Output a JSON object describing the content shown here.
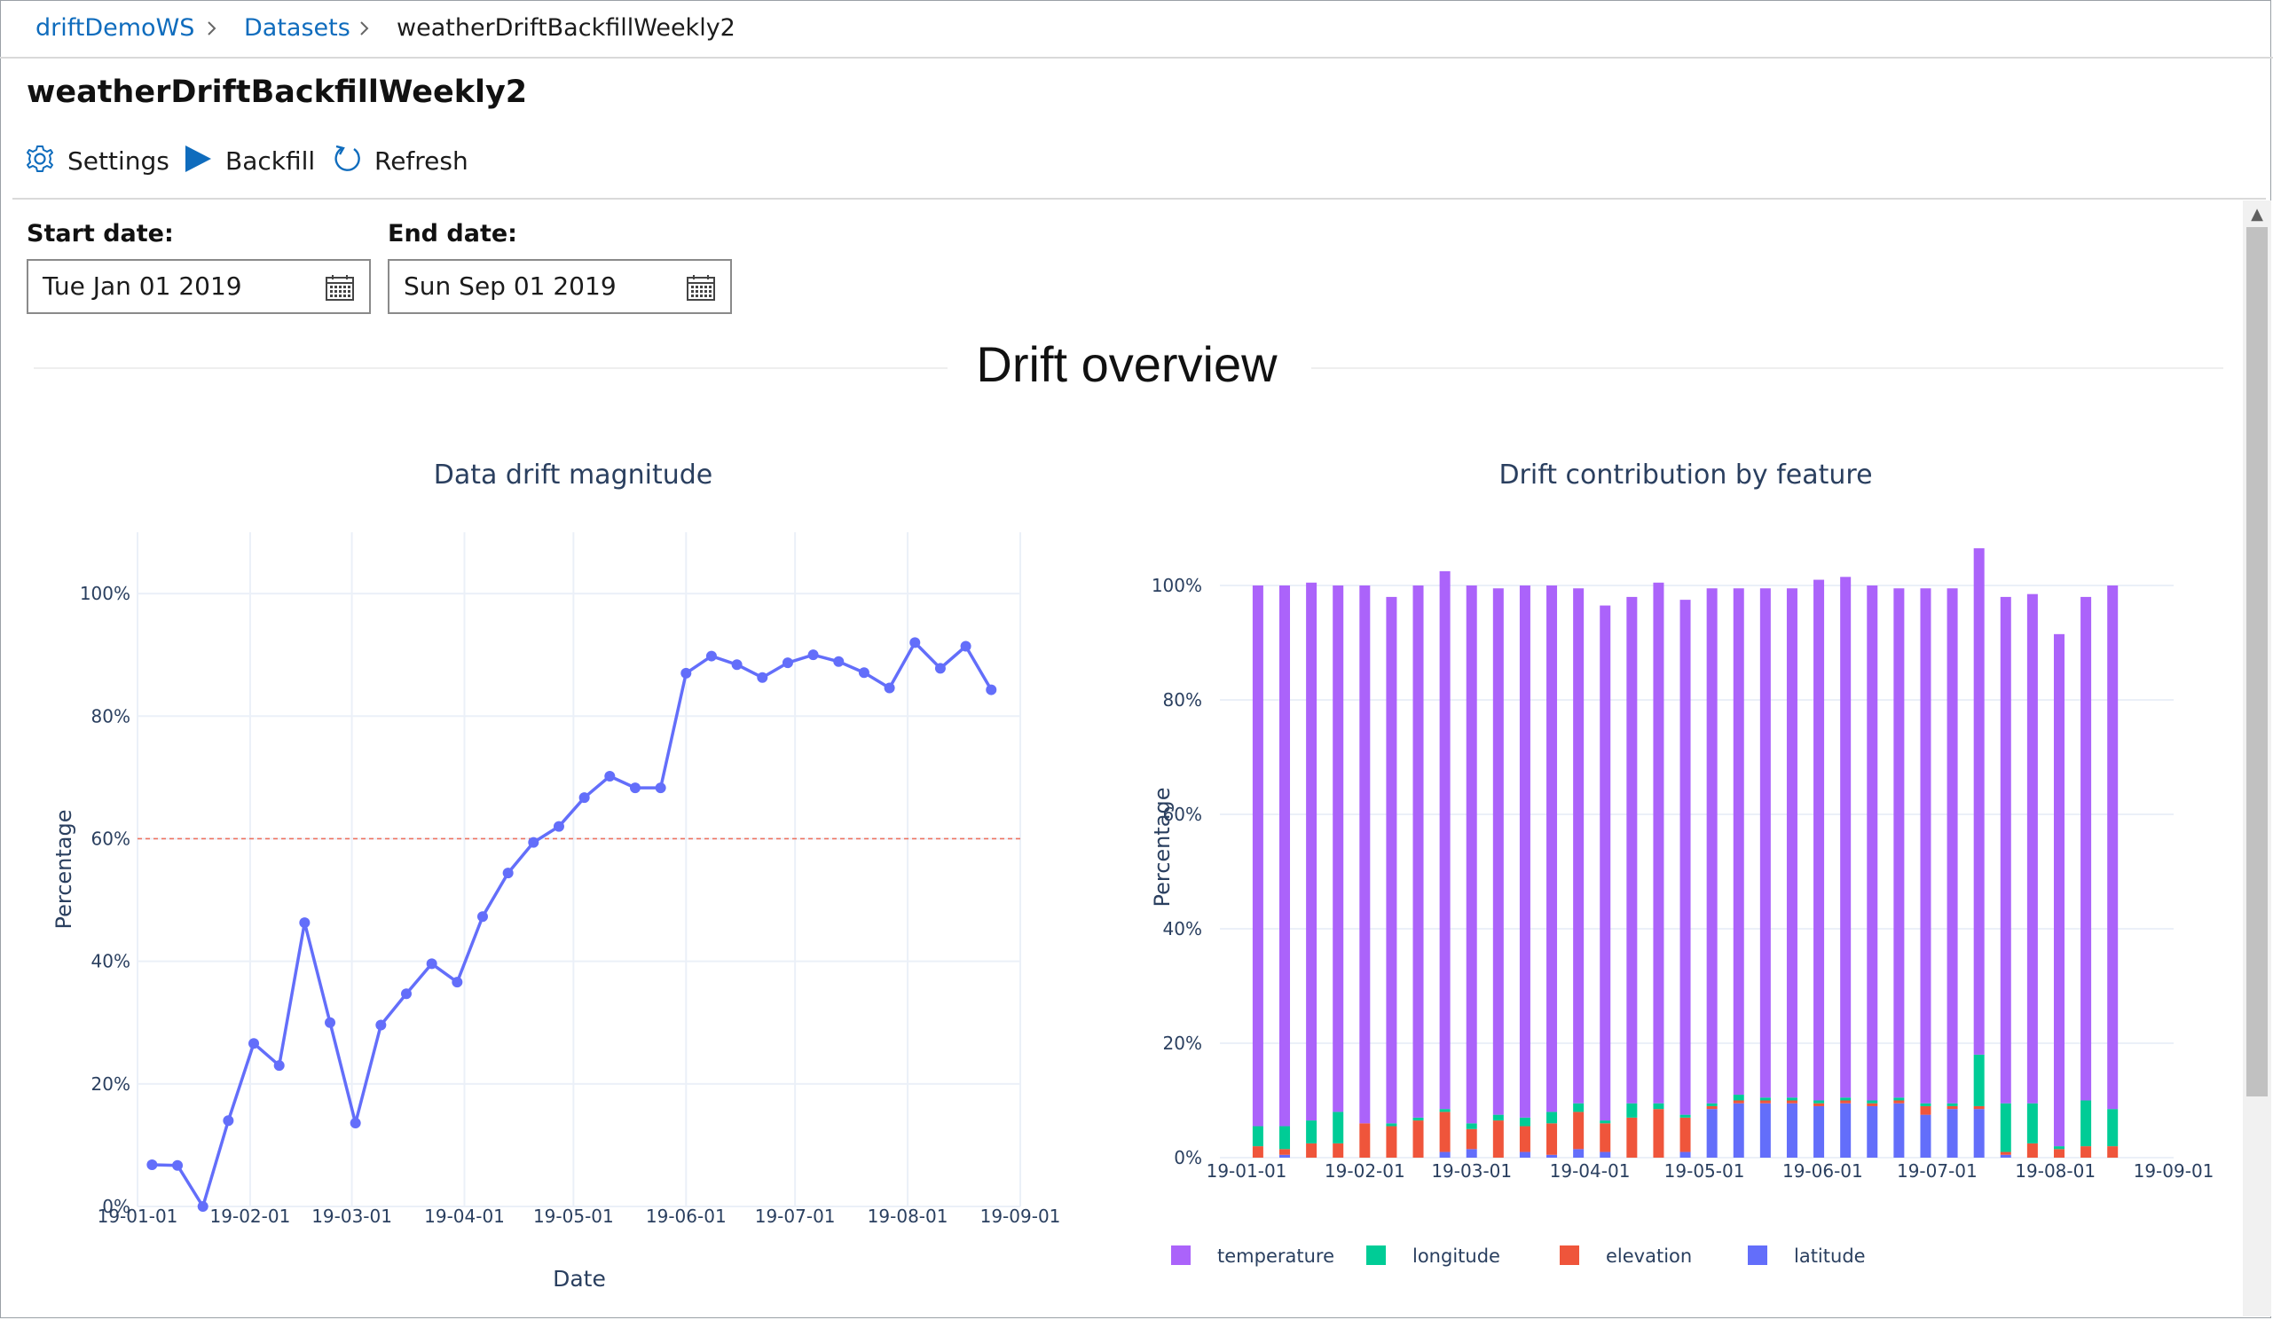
{
  "breadcrumb": {
    "items": [
      "driftDemoWS",
      "Datasets",
      "weatherDriftBackfillWeekly2"
    ]
  },
  "page": {
    "title": "weatherDriftBackfillWeekly2"
  },
  "toolbar": {
    "settings_label": "Settings",
    "backfill_label": "Backfill",
    "refresh_label": "Refresh"
  },
  "filters": {
    "start_label": "Start date:",
    "start_value": "Tue Jan 01 2019",
    "end_label": "End date:",
    "end_value": "Sun Sep 01 2019"
  },
  "section": {
    "title": "Drift overview"
  },
  "colors": {
    "accent": "#0f6cbd",
    "line": "#636efa",
    "threshold": "#ef553b",
    "temperature": "#ab63fa",
    "longitude": "#00cc96",
    "elevation": "#ef553b",
    "latitude": "#636efa"
  },
  "chart_data": [
    {
      "type": "line",
      "title": "Data drift magnitude",
      "xlabel": "Date",
      "ylabel": "Percentage",
      "x_tick_labels": [
        "19-01-01",
        "19-02-01",
        "19-03-01",
        "19-04-01",
        "19-05-01",
        "19-06-01",
        "19-07-01",
        "19-08-01",
        "19-09-01"
      ],
      "y_tick_labels": [
        "0%",
        "20%",
        "40%",
        "60%",
        "80%",
        "100%"
      ],
      "ylim": [
        0,
        110
      ],
      "threshold": 60,
      "series": [
        {
          "x": [
            "2019-01-05",
            "2019-01-12",
            "2019-01-19",
            "2019-01-26",
            "2019-02-02",
            "2019-02-09",
            "2019-02-16",
            "2019-02-23",
            "2019-03-02",
            "2019-03-09",
            "2019-03-16",
            "2019-03-23",
            "2019-03-30",
            "2019-04-06",
            "2019-04-13",
            "2019-04-20",
            "2019-04-27",
            "2019-05-04",
            "2019-05-11",
            "2019-05-18",
            "2019-05-25",
            "2019-06-01",
            "2019-06-08",
            "2019-06-15",
            "2019-06-22",
            "2019-06-29",
            "2019-07-06",
            "2019-07-13",
            "2019-07-20",
            "2019-07-27",
            "2019-08-03",
            "2019-08-10",
            "2019-08-17",
            "2019-08-24"
          ],
          "values": [
            6.8,
            6.7,
            0,
            14,
            26.6,
            23,
            46.3,
            30,
            13.6,
            29.6,
            34.7,
            39.6,
            36.6,
            47.3,
            54.4,
            59.4,
            62,
            66.7,
            70.2,
            68.3,
            68.3,
            87,
            89.8,
            88.4,
            86.3,
            88.7,
            90,
            88.9,
            87.1,
            84.6,
            92,
            87.8,
            91.4,
            84.3
          ]
        }
      ]
    },
    {
      "type": "bar",
      "stacked": true,
      "title": "Drift contribution by feature",
      "ylabel": "Percentage",
      "x_tick_labels": [
        "19-01-01",
        "19-02-01",
        "19-03-01",
        "19-04-01",
        "19-05-01",
        "19-06-01",
        "19-07-01",
        "19-08-01",
        "19-09-01"
      ],
      "y_tick_labels": [
        "0%",
        "20%",
        "40%",
        "60%",
        "80%",
        "100%"
      ],
      "ylim": [
        0,
        100
      ],
      "legend_position": "bottom",
      "series": [
        {
          "name": "temperature",
          "values": [
            94.5,
            94.5,
            94,
            92,
            94,
            92,
            93,
            94,
            94,
            92,
            93,
            92,
            90,
            90,
            88.5,
            91,
            90,
            90,
            88.5,
            89,
            89,
            91,
            91,
            90,
            89,
            90,
            90,
            88.5,
            88.5,
            89,
            89.5,
            88,
            91.5
          ]
        },
        {
          "name": "longitude",
          "values": [
            3.5,
            4,
            4,
            5.5,
            0,
            0.5,
            0.5,
            0.5,
            1,
            1,
            1.5,
            2,
            1.5,
            0.5,
            2.5,
            1,
            0.5,
            0.5,
            1,
            0.5,
            0.5,
            0.5,
            0.5,
            0.5,
            0.5,
            0.5,
            0.5,
            9,
            8.5,
            7,
            0.5,
            8,
            6.5
          ]
        },
        {
          "name": "elevation",
          "values": [
            2,
            1,
            2.5,
            2.5,
            6,
            5.5,
            6.5,
            7,
            3.5,
            6.5,
            4.5,
            5.5,
            6.5,
            5,
            7,
            8.5,
            6,
            0.5,
            0.5,
            0.5,
            0.5,
            0.5,
            0.5,
            0.5,
            0.5,
            1.5,
            0.5,
            0.5,
            0.5,
            2.5,
            1.5,
            2,
            2
          ]
        },
        {
          "name": "latitude",
          "values": [
            0,
            0.5,
            0,
            0,
            0,
            0,
            0,
            1,
            1.5,
            0,
            1,
            0.5,
            1.5,
            1,
            0,
            0,
            1,
            8.5,
            9.5,
            9.5,
            9.5,
            9,
            9.5,
            9,
            9.5,
            7.5,
            8.5,
            8.5,
            0.5,
            0,
            0,
            0,
            0
          ]
        }
      ]
    }
  ]
}
